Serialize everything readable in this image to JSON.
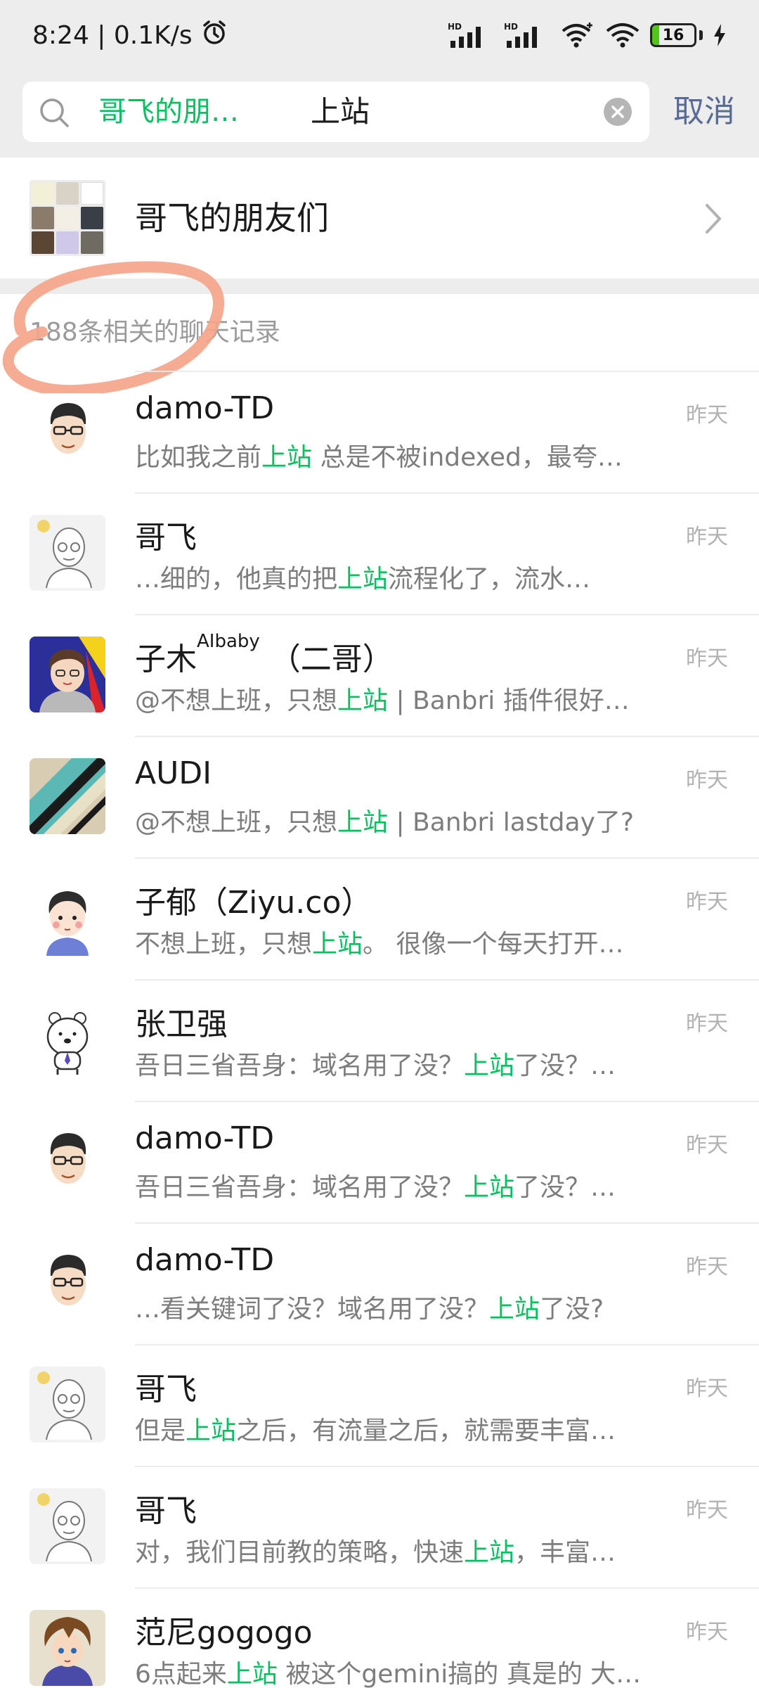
{
  "status_bar": {
    "time_speed": "8:24 | 0.1K/s",
    "battery_level": "16",
    "battery_fraction": 0.16,
    "icons": [
      "alarm-icon",
      "hd-signal-icon",
      "hd-signal-icon",
      "wifi-plus-icon",
      "wifi-icon",
      "battery-icon",
      "charging-icon"
    ]
  },
  "search": {
    "group_tag": "哥飞的朋…",
    "query": "上站",
    "cancel_label": "取消"
  },
  "group": {
    "name": "哥飞的朋友们"
  },
  "section_title": "188条相关的聊天记录",
  "results": [
    {
      "name": "damo-TD",
      "name_sup": "",
      "name_suffix": "",
      "time": "昨天",
      "pre": "比如我之前",
      "hl": "上站",
      "post": " 总是不被indexed，最夸…",
      "avatar": "face-glasses"
    },
    {
      "name": "哥飞",
      "name_sup": "",
      "name_suffix": "",
      "time": "昨天",
      "pre": "…细的，他真的把",
      "hl": "上站",
      "post": "流程化了，流水…",
      "avatar": "sketch"
    },
    {
      "name": "子木",
      "name_sup": "AIbaby",
      "name_suffix": " （二哥）",
      "time": "昨天",
      "pre": "@不想上班，只想",
      "hl": "上站",
      "post": " | Banbri 插件很好…",
      "avatar": "cartoon-boy"
    },
    {
      "name": "AUDI",
      "name_sup": "",
      "name_suffix": "",
      "time": "昨天",
      "pre": "@不想上班，只想",
      "hl": "上站",
      "post": " | Banbri lastday了?",
      "avatar": "stripes"
    },
    {
      "name": "子郁（Ziyu.co）",
      "name_sup": "",
      "name_suffix": "",
      "time": "昨天",
      "pre": "不想上班，只想",
      "hl": "上站",
      "post": "。 很像一个每天打开…",
      "avatar": "kid"
    },
    {
      "name": "张卫强",
      "name_sup": "",
      "name_suffix": "",
      "time": "昨天",
      "pre": "吾日三省吾身：域名用了没？",
      "hl": "上站",
      "post": "了没？…",
      "avatar": "bear"
    },
    {
      "name": "damo-TD",
      "name_sup": "",
      "name_suffix": "",
      "time": "昨天",
      "pre": "吾日三省吾身：域名用了没？",
      "hl": "上站",
      "post": "了没？…",
      "avatar": "face-glasses"
    },
    {
      "name": "damo-TD",
      "name_sup": "",
      "name_suffix": "",
      "time": "昨天",
      "pre": "…看关键词了没？域名用了没？",
      "hl": "上站",
      "post": "了没?",
      "avatar": "face-glasses"
    },
    {
      "name": "哥飞",
      "name_sup": "",
      "name_suffix": "",
      "time": "昨天",
      "pre": "但是",
      "hl": "上站",
      "post": "之后，有流量之后，就需要丰富…",
      "avatar": "sketch"
    },
    {
      "name": "哥飞",
      "name_sup": "",
      "name_suffix": "",
      "time": "昨天",
      "pre": "对，我们目前教的策略，快速",
      "hl": "上站",
      "post": "，丰富…",
      "avatar": "sketch"
    },
    {
      "name": "范尼gogogo",
      "name_sup": "",
      "name_suffix": "",
      "time": "昨天",
      "pre": "6点起来",
      "hl": "上站",
      "post": " 被这个gemini搞的 真是的 大…",
      "avatar": "anime"
    }
  ],
  "colors": {
    "highlight": "#07c160",
    "cancel": "#576b95",
    "header_bg": "#ededed",
    "circle_annotation": "#f4a58a"
  }
}
